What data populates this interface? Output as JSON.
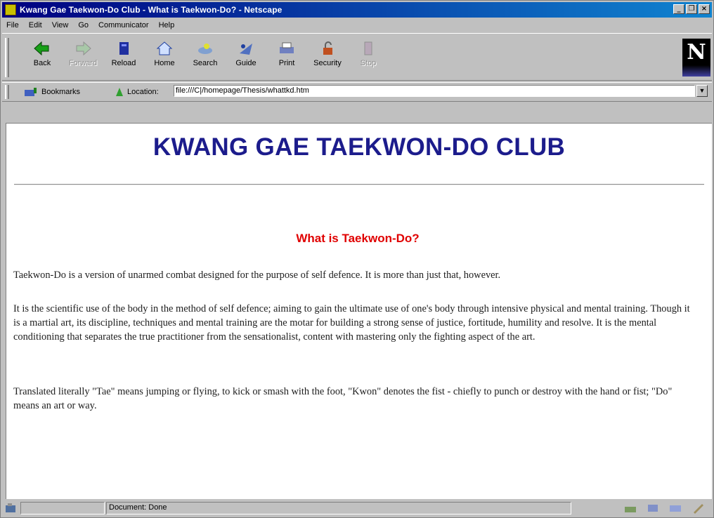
{
  "window": {
    "title": "Kwang Gae Taekwon-Do Club - What is Taekwon-Do? - Netscape",
    "controls": [
      "_",
      "❐",
      "×"
    ]
  },
  "menu": [
    "File",
    "Edit",
    "View",
    "Go",
    "Communicator",
    "Help"
  ],
  "toolbar": {
    "buttons": [
      {
        "label": "Back",
        "icon": "back-arrow-icon",
        "enabled": true
      },
      {
        "label": "Forward",
        "icon": "forward-arrow-icon",
        "enabled": false
      },
      {
        "label": "Reload",
        "icon": "reload-icon",
        "enabled": true
      },
      {
        "label": "Home",
        "icon": "home-icon",
        "enabled": true
      },
      {
        "label": "Search",
        "icon": "search-icon",
        "enabled": true
      },
      {
        "label": "Guide",
        "icon": "guide-icon",
        "enabled": true
      },
      {
        "label": "Print",
        "icon": "print-icon",
        "enabled": true
      },
      {
        "label": "Security",
        "icon": "security-lock-icon",
        "enabled": true
      },
      {
        "label": "Stop",
        "icon": "stop-icon",
        "enabled": false
      }
    ],
    "logo_letter": "N"
  },
  "location": {
    "bookmarks_label": "Bookmarks",
    "location_label": "Location:",
    "url": "file:///C|/homepage/Thesis/whattkd.htm"
  },
  "page": {
    "site_title": "KWANG GAE TAEKWON-DO CLUB",
    "section_title": "What is Taekwon-Do?",
    "paragraphs": [
      "Taekwon-Do is a version of unarmed combat designed for the purpose of self defence. It is more than just that, however.",
      "It is the scientific use of the body in the method of self defence; aiming to gain the ultimate use of one's body through intensive physical and mental training. Though it is a martial art, its discipline, techniques and mental training are the motar for building a strong sense of justice, fortitude, humility and resolve. It is the mental conditioning that separates the true practitioner from the sensationalist, content with mastering only the fighting aspect of the art.",
      "Translated literally \"Tae\" means jumping or flying, to kick or smash with the foot, \"Kwon\" denotes the fist - chiefly to punch or destroy with the hand or fist; \"Do\" means an art or way."
    ]
  },
  "status": {
    "text": "Document: Done"
  },
  "colors": {
    "title_bar": "#000080",
    "site_title": "#1c1c8c",
    "section_title": "#e00000"
  }
}
